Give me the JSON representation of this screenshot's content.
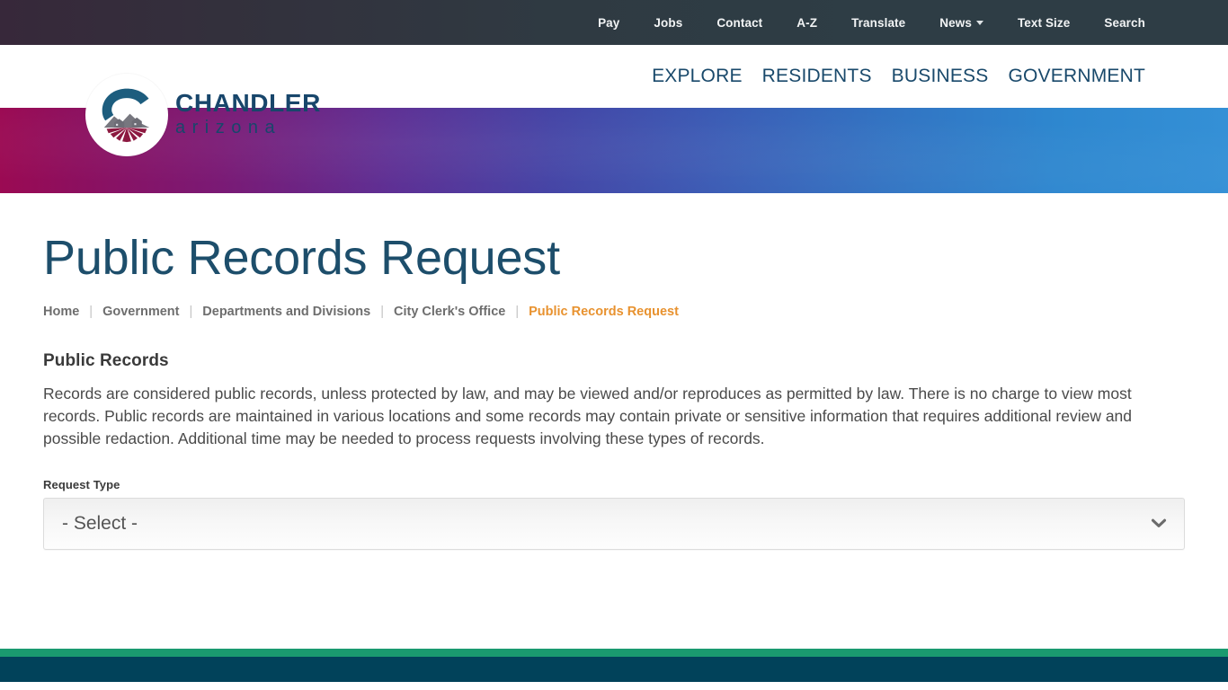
{
  "utility_bar": {
    "items": [
      {
        "label": "Pay",
        "has_caret": false
      },
      {
        "label": "Jobs",
        "has_caret": false
      },
      {
        "label": "Contact",
        "has_caret": false
      },
      {
        "label": "A-Z",
        "has_caret": false
      },
      {
        "label": "Translate",
        "has_caret": false
      },
      {
        "label": "News",
        "has_caret": true
      },
      {
        "label": "Text Size",
        "has_caret": false
      },
      {
        "label": "Search",
        "has_caret": false
      }
    ]
  },
  "logo": {
    "main_text": "CHANDLER",
    "sub_text": "arizona",
    "icon": "chandler-city-seal-icon",
    "colors": {
      "teal_arc": "#1d5d7e",
      "mountain_gray": "#77777f",
      "field_maroon": "#8c1940",
      "wordmark": "#18466b"
    }
  },
  "main_nav": {
    "items": [
      {
        "label": "EXPLORE"
      },
      {
        "label": "RESIDENTS"
      },
      {
        "label": "BUSINESS"
      },
      {
        "label": "GOVERNMENT"
      }
    ]
  },
  "banner": {
    "gradient_start": "#9b0a53",
    "gradient_mid": "#4343a5",
    "gradient_end": "#3490d6"
  },
  "page": {
    "title": "Public Records Request"
  },
  "breadcrumb": {
    "separator": "|",
    "items": [
      {
        "label": "Home",
        "current": false
      },
      {
        "label": "Government",
        "current": false
      },
      {
        "label": "Departments and Divisions",
        "current": false
      },
      {
        "label": "City Clerk's Office",
        "current": false
      },
      {
        "label": "Public Records Request",
        "current": true
      }
    ],
    "current_color": "#e8922f"
  },
  "main": {
    "section_title": "Public Records",
    "paragraph": "Records are considered public records, unless protected by law, and may be viewed and/or reproduces as permitted by law. There is no charge to view most records. Public records are maintained in various locations and some records may contain private or sensitive information that requires additional review and possible redaction. Additional time may be needed to process requests involving these types of records."
  },
  "form": {
    "request_type": {
      "label": "Request Type",
      "selected_value": "- Select -",
      "chevron_icon": "chevron-down-icon"
    }
  },
  "footer": {
    "green_bar_color": "#1a9a6f",
    "navy_bar_color": "#01425a"
  }
}
